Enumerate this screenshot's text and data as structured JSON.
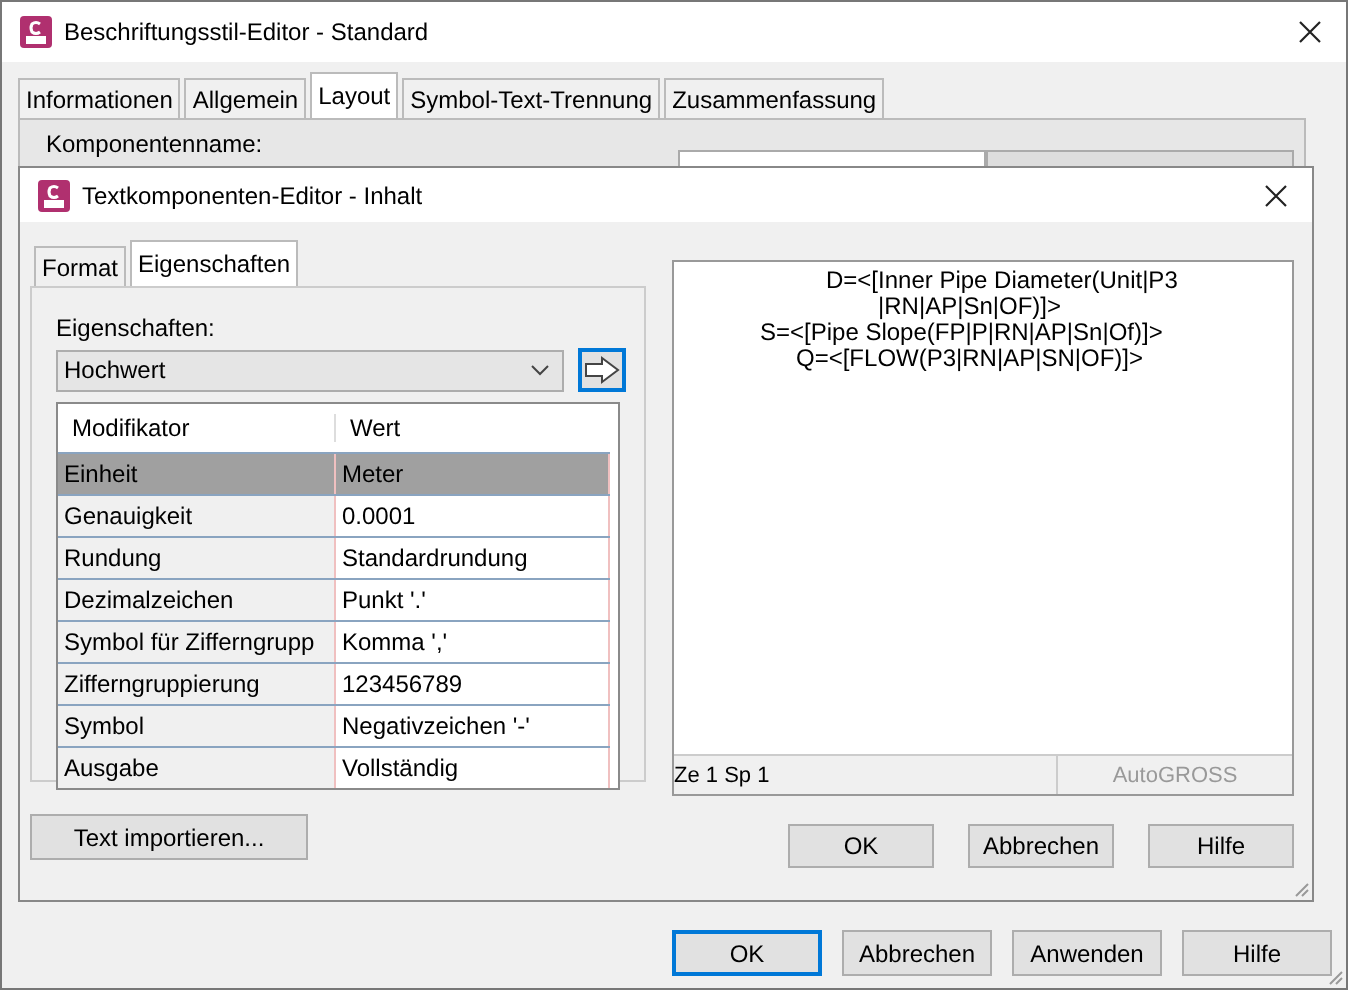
{
  "window": {
    "title": "Beschriftungsstil-Editor - Standard"
  },
  "tabs": [
    {
      "label": "Informationen",
      "selected": false
    },
    {
      "label": "Allgemein",
      "selected": false
    },
    {
      "label": "Layout",
      "selected": true
    },
    {
      "label": "Symbol-Text-Trennung",
      "selected": false
    },
    {
      "label": "Zusammenfassung",
      "selected": false
    }
  ],
  "layout_panel": {
    "component_name_label": "Komponentenname:"
  },
  "dialog": {
    "title": "Textkomponenten-Editor - Inhalt",
    "tabs": [
      {
        "label": "Format",
        "selected": false
      },
      {
        "label": "Eigenschaften",
        "selected": true
      }
    ],
    "properties_label": "Eigenschaften:",
    "properties_dropdown": {
      "value": "Hochwert"
    },
    "table": {
      "columns": [
        "Modifikator",
        "Wert"
      ],
      "rows": [
        {
          "cells": [
            "Einheit",
            "Meter"
          ],
          "selected": true
        },
        {
          "cells": [
            "Genauigkeit",
            "0.0001"
          ],
          "selected": false
        },
        {
          "cells": [
            "Rundung",
            "Standardrundung"
          ],
          "selected": false
        },
        {
          "cells": [
            "Dezimalzeichen",
            "Punkt '.'"
          ],
          "selected": false
        },
        {
          "cells": [
            "Symbol für Zifferngrupp",
            "Komma ','"
          ],
          "selected": false
        },
        {
          "cells": [
            "Zifferngruppierung",
            "123456789"
          ],
          "selected": false
        },
        {
          "cells": [
            "Symbol",
            "Negativzeichen '-'"
          ],
          "selected": false
        },
        {
          "cells": [
            "Ausgabe",
            "Vollständig"
          ],
          "selected": false
        }
      ]
    },
    "import_button": "Text importieren...",
    "editor_lines": [
      "D=<[Inner Pipe Diameter(Unit|P3",
      "|RN|AP|Sn|OF)]>",
      "S=<[Pipe Slope(FP|P|RN|AP|Sn|Of)]>",
      "Q=<[FLOW(P3|RN|AP|SN|OF)]>"
    ],
    "status_bar": {
      "position": "Ze 1 Sp 1",
      "caps": "AutoGROSS"
    },
    "buttons": [
      "OK",
      "Abbrechen",
      "Hilfe"
    ]
  },
  "buttons": [
    "OK",
    "Abbrechen",
    "Anwenden",
    "Hilfe"
  ]
}
